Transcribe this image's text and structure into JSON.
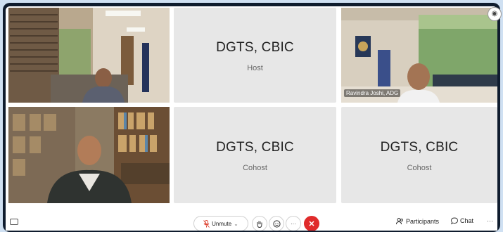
{
  "tiles": [
    {
      "name": "DGTS, CBIC",
      "role": "Host"
    },
    {
      "name": "DGTS, CBIC",
      "role": "Cohost"
    },
    {
      "name": "DGTS, CBIC",
      "role": "Cohost"
    }
  ],
  "video_tiles": {
    "ravindra": {
      "name_tag": "Ravindra Joshi, ADG"
    }
  },
  "toolbar": {
    "unmute_label": "Unmute",
    "unmute_caret": "⌄",
    "more_label": "···",
    "end_label": "✕",
    "participants_label": "Participants",
    "chat_label": "Chat",
    "overflow_label": "···"
  },
  "icons": {
    "captions": "captions-icon",
    "mic": "mic-muted-icon",
    "hand": "raise-hand-icon",
    "reactions": "reactions-icon",
    "participants": "participants-icon",
    "chat": "chat-icon"
  },
  "colors": {
    "end_call": "#e02b2b",
    "tile_bg": "#e7e7e7",
    "frame": "#0f1c2e"
  }
}
